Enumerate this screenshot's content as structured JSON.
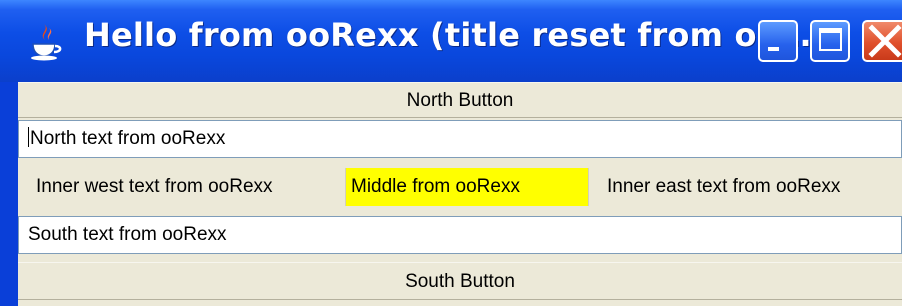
{
  "window": {
    "title": "Hello from ooRexx (title reset from oo…",
    "app_icon": "java-icon",
    "controls": {
      "minimize": "minimize-icon",
      "maximize": "maximize-icon",
      "close": "close-icon"
    }
  },
  "north_button": {
    "label": "North Button"
  },
  "north_field": {
    "value": "North text from ooRexx"
  },
  "center_row": {
    "west_label": "Inner west text from ooRexx",
    "middle_label": "Middle from ooRexx",
    "middle_bg": "#ffff00",
    "east_label": "Inner east text from ooRexx"
  },
  "south_field": {
    "value": "South text from ooRexx"
  },
  "south_button": {
    "label": "South Button"
  },
  "colors": {
    "titlebar": "#0a47dc",
    "panel": "#ece9d8",
    "close": "#e0502c"
  }
}
